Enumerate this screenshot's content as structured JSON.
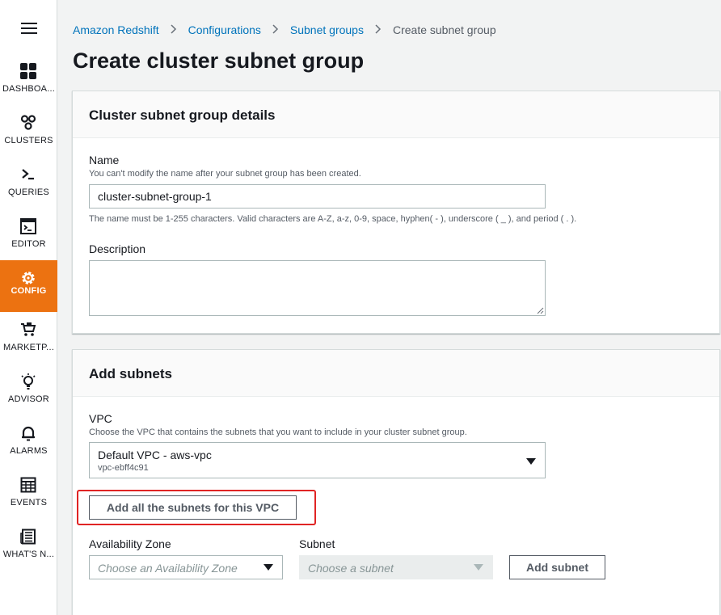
{
  "sidebar": {
    "items": [
      {
        "label": "DASHBOA..."
      },
      {
        "label": "CLUSTERS"
      },
      {
        "label": "QUERIES"
      },
      {
        "label": "EDITOR"
      },
      {
        "label": "CONFIG"
      },
      {
        "label": "MARKETP..."
      },
      {
        "label": "ADVISOR"
      },
      {
        "label": "ALARMS"
      },
      {
        "label": "EVENTS"
      },
      {
        "label": "WHAT'S N..."
      }
    ],
    "active_color": "#ec7211"
  },
  "breadcrumb": {
    "items": [
      "Amazon Redshift",
      "Configurations",
      "Subnet groups"
    ],
    "current": "Create subnet group"
  },
  "page_title": "Create cluster subnet group",
  "details": {
    "title": "Cluster subnet group details",
    "name_label": "Name",
    "name_hint": "You can't modify the name after your subnet group has been created.",
    "name_value": "cluster-subnet-group-1",
    "name_constraint": "The name must be 1-255 characters. Valid characters are A-Z, a-z, 0-9, space, hyphen( - ), underscore ( _ ), and period ( . ).",
    "description_label": "Description",
    "description_value": ""
  },
  "subnets": {
    "title": "Add subnets",
    "vpc_label": "VPC",
    "vpc_hint": "Choose the VPC that contains the subnets that you want to include in your cluster subnet group.",
    "vpc_selected": "Default VPC - aws-vpc",
    "vpc_id": "vpc-ebff4c91",
    "add_all_label": "Add all the subnets for this VPC",
    "az_label": "Availability Zone",
    "az_placeholder": "Choose an Availability Zone",
    "subnet_label": "Subnet",
    "subnet_placeholder": "Choose a subnet",
    "add_subnet_label": "Add subnet"
  }
}
